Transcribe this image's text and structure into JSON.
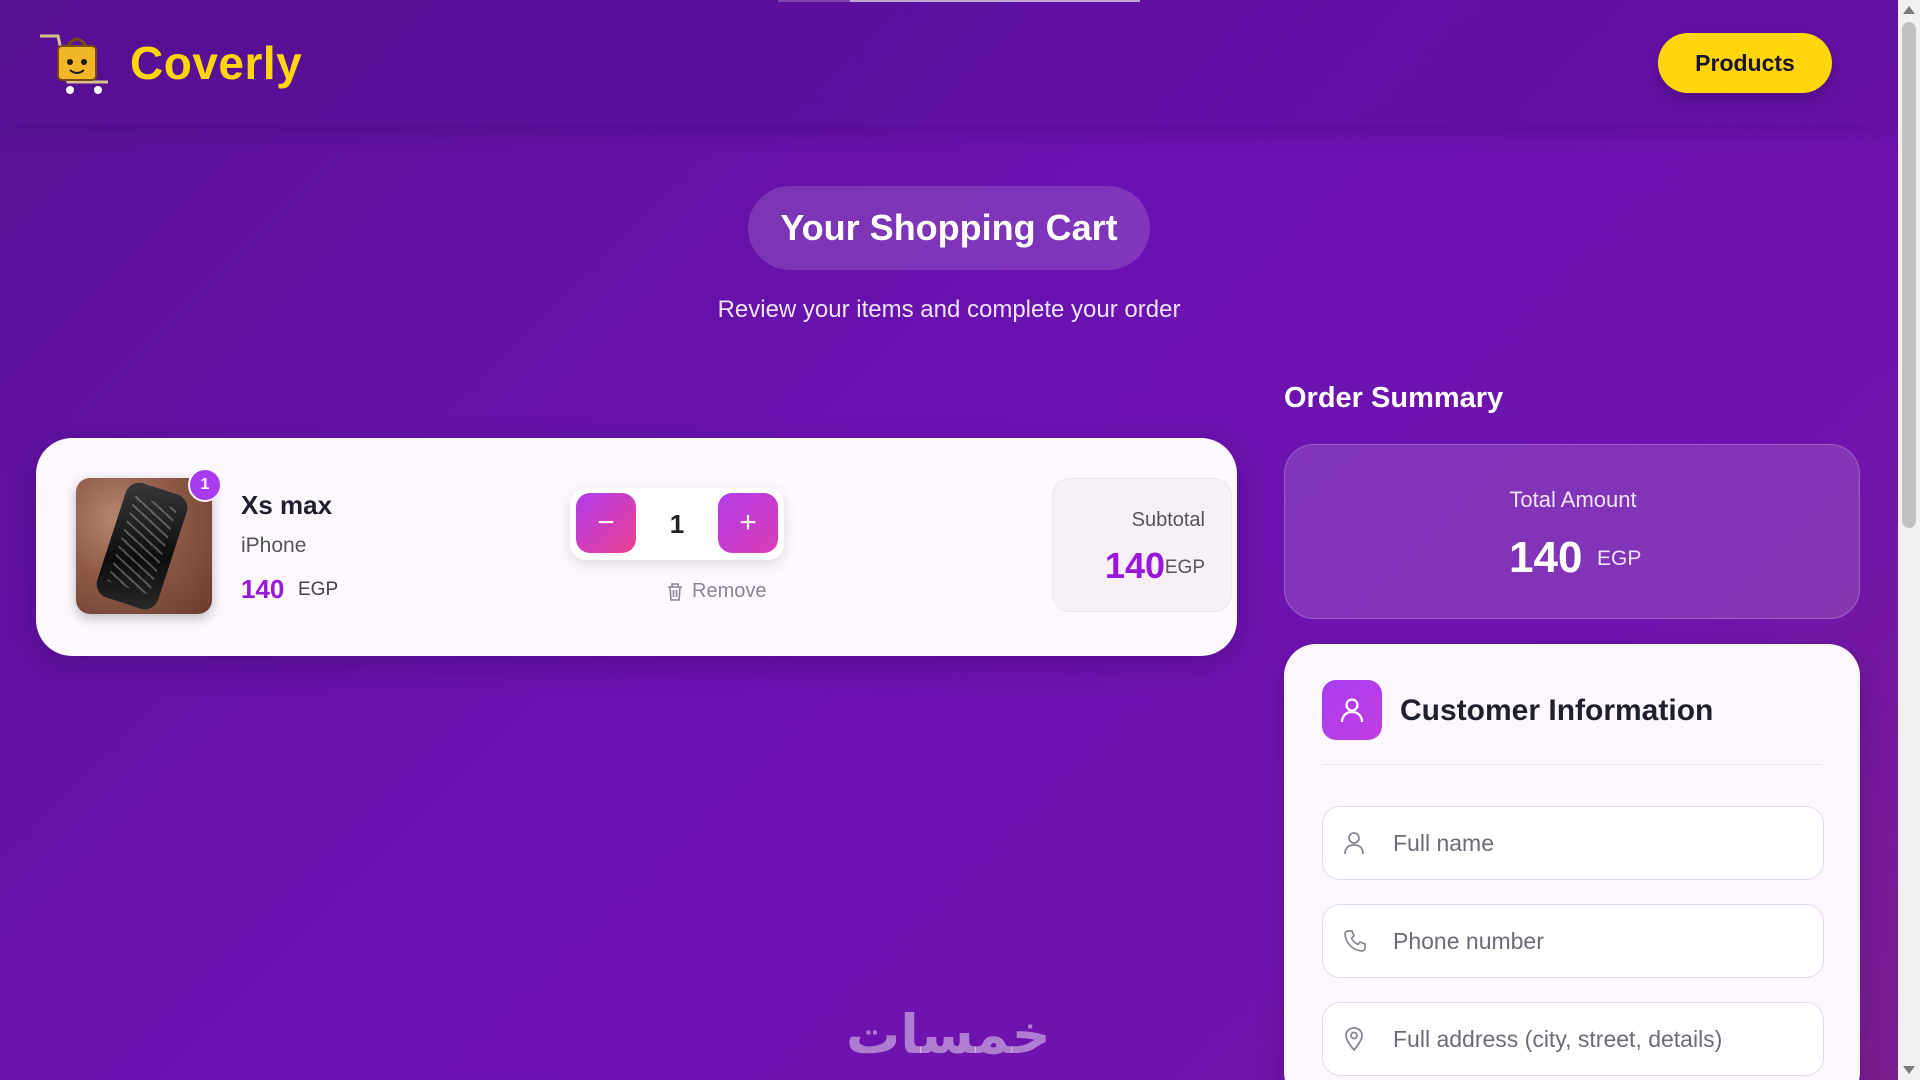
{
  "header": {
    "brand": "Coverly",
    "products_label": "Products"
  },
  "cart": {
    "title": "Your Shopping Cart",
    "subtitle": "Review your items and complete your order",
    "item": {
      "name": "Xs max",
      "category": "iPhone",
      "price": "140",
      "currency": "EGP",
      "quantity_badge": "1",
      "quantity": "1",
      "minus_label": "−",
      "plus_label": "+",
      "remove_label": "Remove",
      "subtotal_label": "Subtotal",
      "subtotal_value": "140",
      "subtotal_currency": "EGP"
    }
  },
  "summary": {
    "title": "Order Summary",
    "total_label": "Total Amount",
    "total_value": "140",
    "total_currency": "EGP"
  },
  "customer": {
    "title": "Customer Information",
    "full_name_placeholder": "Full name",
    "phone_placeholder": "Phone number",
    "address_placeholder": "Full address (city, street, details)"
  },
  "watermark": "خمسات",
  "colors": {
    "accent": "#ffd60a",
    "price": "#9a16d8",
    "background": "#6a12b0"
  }
}
